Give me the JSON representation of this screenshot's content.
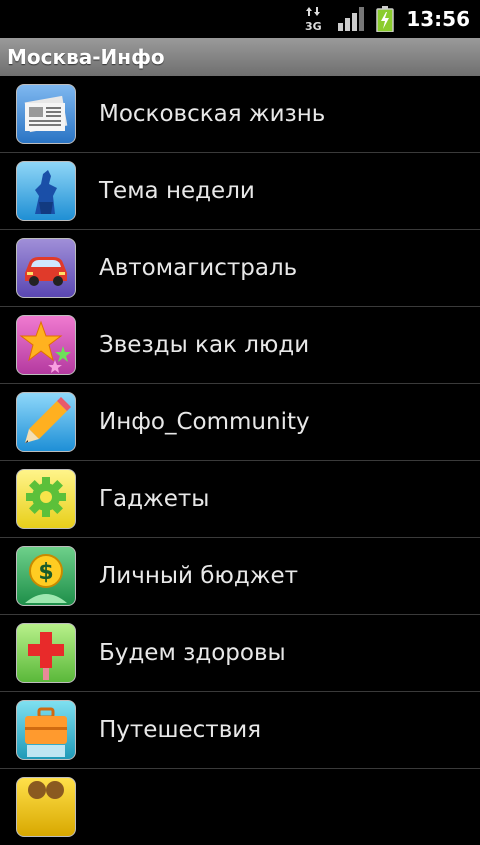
{
  "statusbar": {
    "network_label": "3G",
    "time": "13:56",
    "icons": [
      "data-3g-icon",
      "signal-icon",
      "battery-charging-icon"
    ],
    "battery_color": "#8bcc2e"
  },
  "app": {
    "title": "Москва-Инфо",
    "title_bar_color": "#8a8a8a"
  },
  "menu": {
    "items": [
      {
        "label": "Московская жизнь",
        "icon": "newspaper-icon"
      },
      {
        "label": "Тема недели",
        "icon": "monument-icon"
      },
      {
        "label": "Автомагистраль",
        "icon": "car-icon"
      },
      {
        "label": "Звезды как люди",
        "icon": "stars-icon"
      },
      {
        "label": "Инфо_Community",
        "icon": "pencil-icon"
      },
      {
        "label": "Гаджеты",
        "icon": "gear-icon"
      },
      {
        "label": "Личный бюджет",
        "icon": "dollar-icon"
      },
      {
        "label": "Будем здоровы",
        "icon": "health-cross-icon"
      },
      {
        "label": "Путешествия",
        "icon": "suitcase-icon"
      }
    ]
  }
}
